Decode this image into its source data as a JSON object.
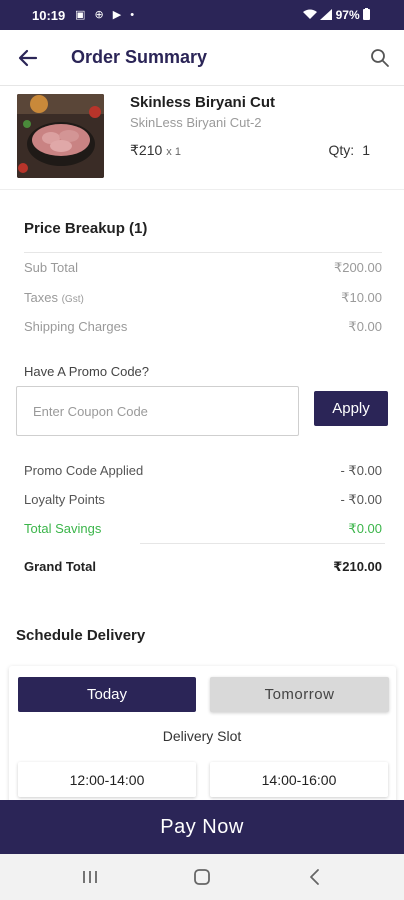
{
  "status_bar": {
    "time": "10:19",
    "notifications": "▣ ⊕ ▶ •",
    "battery": "97%"
  },
  "header": {
    "title": "Order Summary"
  },
  "item": {
    "name": "Skinless Biryani Cut",
    "variant": "SkinLess Biryani Cut-2",
    "price": "₹210",
    "multiplier": "x 1",
    "qty_label": "Qty:",
    "qty_value": "1"
  },
  "price_breakup": {
    "title": "Price Breakup (1)",
    "subtotal_label": "Sub Total",
    "subtotal_value": "₹200.00",
    "taxes_label": "Taxes",
    "taxes_note": "(Gst)",
    "taxes_value": "₹10.00",
    "shipping_label": "Shipping Charges",
    "shipping_value": "₹0.00"
  },
  "promo": {
    "label": "Have A Promo Code?",
    "placeholder": "Enter Coupon Code",
    "value": "",
    "apply_label": "Apply"
  },
  "summary": {
    "promo_applied_label": "Promo Code Applied",
    "promo_applied_value": "- ₹0.00",
    "loyalty_label": "Loyalty Points",
    "loyalty_value": "- ₹0.00",
    "savings_label": "Total Savings",
    "savings_value": "₹0.00",
    "grand_label": "Grand Total",
    "grand_value": "₹210.00"
  },
  "schedule": {
    "title": "Schedule Delivery",
    "today_label": "Today",
    "tomorrow_label": "Tomorrow",
    "slot_label": "Delivery Slot",
    "slots": [
      "12:00-14:00",
      "14:00-16:00"
    ]
  },
  "pay_button": "Pay Now",
  "colors": {
    "primary": "#2b2557",
    "savings_green": "#3bb54a",
    "inactive_gray": "#d9d9d9"
  }
}
